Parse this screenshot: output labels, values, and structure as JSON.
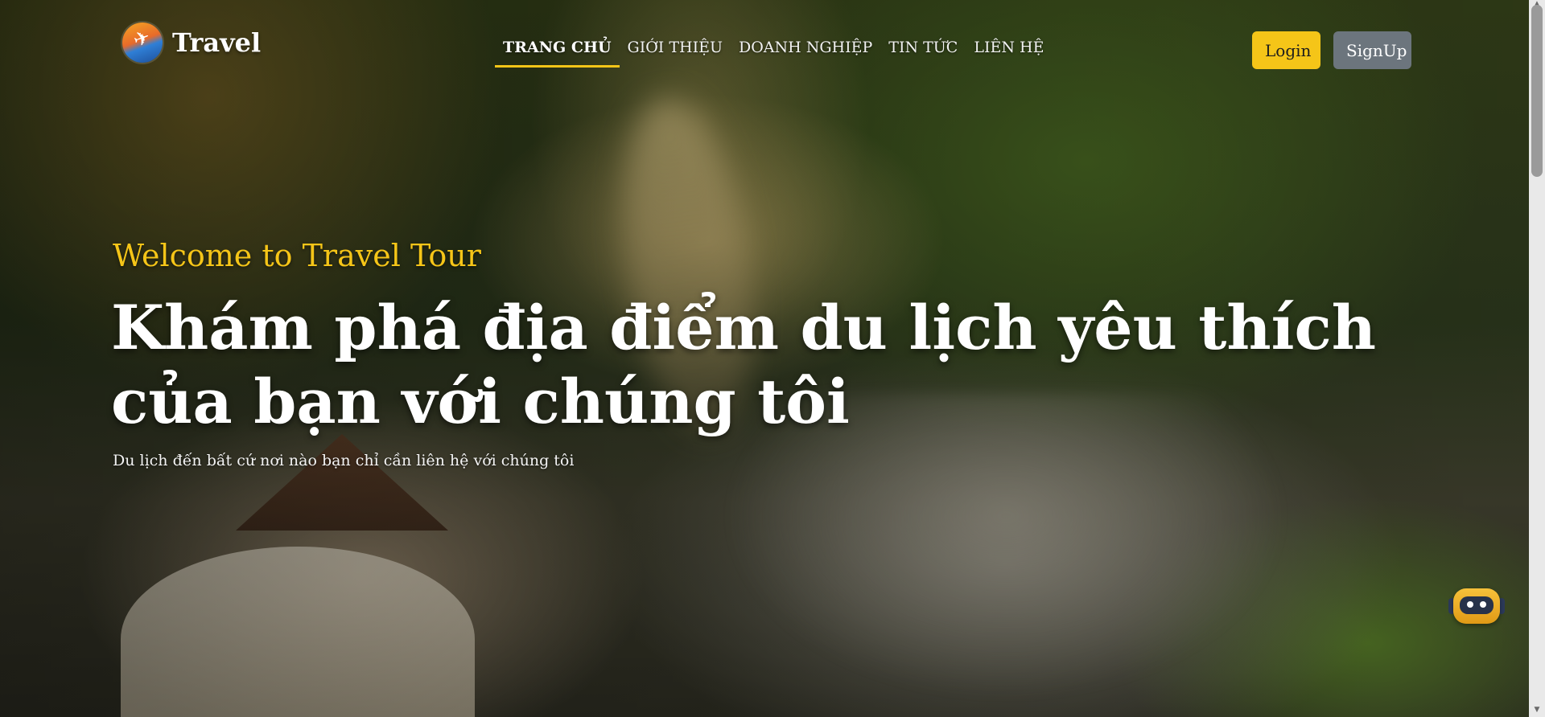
{
  "brand": {
    "name": "Travel"
  },
  "nav": {
    "items": [
      {
        "label": "TRANG CHỦ",
        "active": true
      },
      {
        "label": "GIỚI THIỆU",
        "active": false
      },
      {
        "label": "DOANH NGHIỆP",
        "active": false
      },
      {
        "label": "TIN TỨC",
        "active": false
      },
      {
        "label": "LIÊN HỆ",
        "active": false
      }
    ]
  },
  "auth": {
    "login_label": "Login",
    "signup_label": "SignUp"
  },
  "hero": {
    "welcome": "Welcome to Travel Tour",
    "headline": "Khám phá địa điểm du lịch yêu thích của bạn với chúng tôi",
    "subtitle": "Du lịch đến bất cứ nơi nào bạn chỉ cần liên hệ với chúng tôi"
  },
  "colors": {
    "accent": "#f5c518",
    "signup": "#6c757d"
  },
  "icons": {
    "logo": "airplane-logo-icon",
    "chatbot": "robot-chat-icon"
  }
}
